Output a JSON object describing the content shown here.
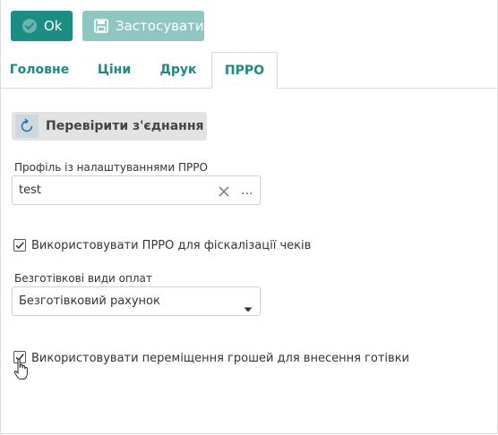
{
  "toolbar": {
    "ok_label": "Ok",
    "apply_label": "Застосувати"
  },
  "tabs": [
    {
      "label": "Головне",
      "active": false
    },
    {
      "label": "Ціни",
      "active": false
    },
    {
      "label": "Друк",
      "active": false
    },
    {
      "label": "ПРРО",
      "active": true
    }
  ],
  "prro": {
    "check_connection_label": "Перевірити з'єднання",
    "profile_label": "Профіль із налаштуваннями ПРРО",
    "profile_value": "test",
    "more_label": "...",
    "use_prro_label": "Використовувати ПРРО для фіскалізації чеків",
    "use_prro_checked": true,
    "cashless_label": "Безготівкові види оплат",
    "cashless_value": "Безготівковий рахунок",
    "use_transfer_label": "Використовувати переміщення грошей для внесення готівки",
    "use_transfer_checked": true
  },
  "colors": {
    "accent": "#1b8d84",
    "accent_disabled": "#8fc6c1",
    "tab_text": "#1f8a80"
  },
  "icons": {
    "ok": "check-circle-icon",
    "apply": "save-icon",
    "check_connection": "refresh-icon",
    "clear": "close-icon",
    "dropdown": "caret-down-icon",
    "cursor": "hand-pointer-icon"
  }
}
